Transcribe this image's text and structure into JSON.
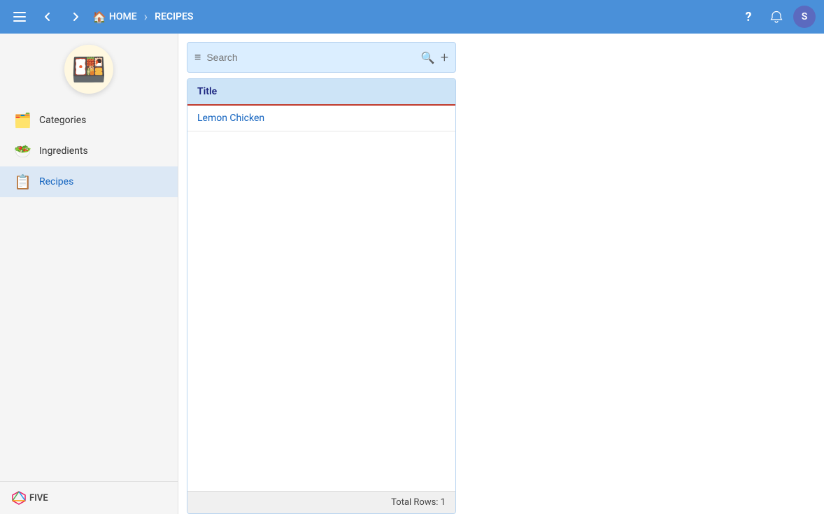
{
  "topbar": {
    "home_label": "HOME",
    "current_label": "RECIPES",
    "help_icon": "?",
    "bell_icon": "🔔",
    "avatar_label": "S"
  },
  "sidebar": {
    "logo_emoji": "🍱",
    "items": [
      {
        "id": "categories",
        "label": "Categories",
        "icon": "🗂️",
        "active": false
      },
      {
        "id": "ingredients",
        "label": "Ingredients",
        "icon": "🥗",
        "active": false
      },
      {
        "id": "recipes",
        "label": "Recipes",
        "icon": "📋",
        "active": true
      }
    ],
    "footer": {
      "brand_label": "FIVE"
    }
  },
  "search": {
    "placeholder": "Search",
    "filter_icon": "≡",
    "search_icon": "🔍",
    "add_icon": "+"
  },
  "table": {
    "columns": [
      "Title"
    ],
    "rows": [
      {
        "title": "Lemon Chicken"
      }
    ],
    "footer_label": "Total Rows: 1"
  }
}
